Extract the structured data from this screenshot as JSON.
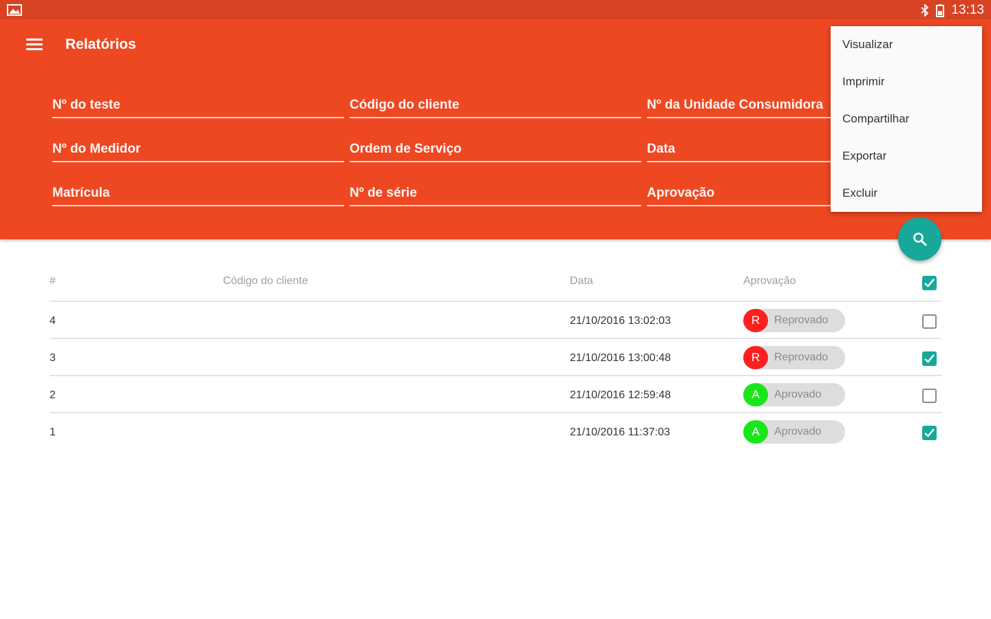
{
  "status_bar": {
    "time": "13:13",
    "icons": [
      "image-icon",
      "bluetooth-icon",
      "battery-icon"
    ]
  },
  "app_bar": {
    "title": "Relatórios",
    "menu_icon": "hamburger-menu-icon",
    "color": "#ee4822"
  },
  "filters": [
    {
      "label": "Nº do teste"
    },
    {
      "label": "Código do cliente"
    },
    {
      "label": "Nº da Unidade Consumidora"
    },
    {
      "label": "Nº do Medidor"
    },
    {
      "label": "Ordem de Serviço"
    },
    {
      "label": "Data"
    },
    {
      "label": "Matrícula"
    },
    {
      "label": "Nº de série"
    },
    {
      "label": "Aprovação"
    }
  ],
  "overflow_menu": {
    "items": [
      "Visualizar",
      "Imprimir",
      "Compartilhar",
      "Exportar",
      "Excluir"
    ]
  },
  "search_fab": {
    "icon": "search-icon",
    "color": "#17a89a"
  },
  "table": {
    "headers": {
      "number": "#",
      "client_code": "Código do cliente",
      "date": "Data",
      "approval": "Aprovação"
    },
    "header_checked": true,
    "rows": [
      {
        "number": "4",
        "client_code": "",
        "date": "21/10/2016 13:02:03",
        "initial": "R",
        "status": "Reprovado",
        "status_color": "#ff1f1f",
        "checked": false
      },
      {
        "number": "3",
        "client_code": "",
        "date": "21/10/2016 13:00:48",
        "initial": "R",
        "status": "Reprovado",
        "status_color": "#ff1f1f",
        "checked": true
      },
      {
        "number": "2",
        "client_code": "",
        "date": "21/10/2016 12:59:48",
        "initial": "A",
        "status": "Aprovado",
        "status_color": "#19e619",
        "checked": false
      },
      {
        "number": "1",
        "client_code": "",
        "date": "21/10/2016 11:37:03",
        "initial": "A",
        "status": "Aprovado",
        "status_color": "#19e619",
        "checked": true
      }
    ]
  }
}
